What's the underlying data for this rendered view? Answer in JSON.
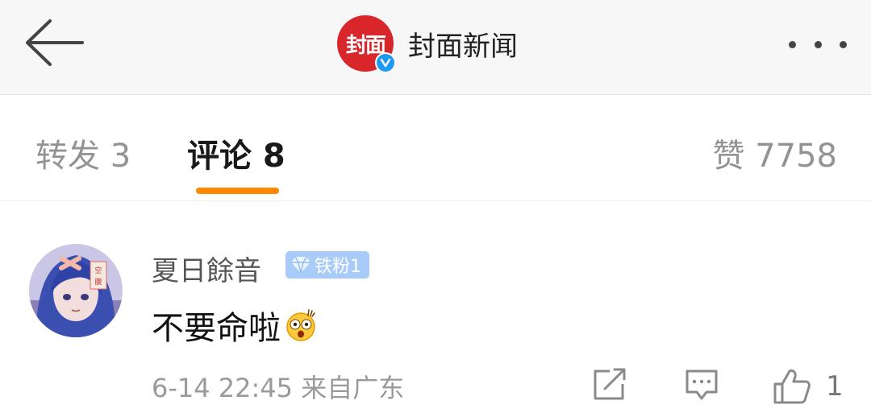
{
  "header": {
    "account_name": "封面新闻",
    "logo_text": "封面"
  },
  "tabs": {
    "repost": "转发 3",
    "comment": "评论 8",
    "like": "赞 7758"
  },
  "comment": {
    "username": "夏日餘音",
    "badge": "铁粉1",
    "text": "不要命啦",
    "meta": "6-14 22:45  来自广东",
    "like_count": "1"
  },
  "colors": {
    "accent": "#ff8a00",
    "logo": "#d9262b",
    "verified": "#1d9bf0",
    "badge": "#a8ccf7"
  },
  "icons": [
    "back-arrow-icon",
    "verified-icon",
    "more-icon",
    "diamond-icon",
    "surprised-emoji-icon",
    "share-icon",
    "reply-icon",
    "thumbs-up-icon"
  ]
}
